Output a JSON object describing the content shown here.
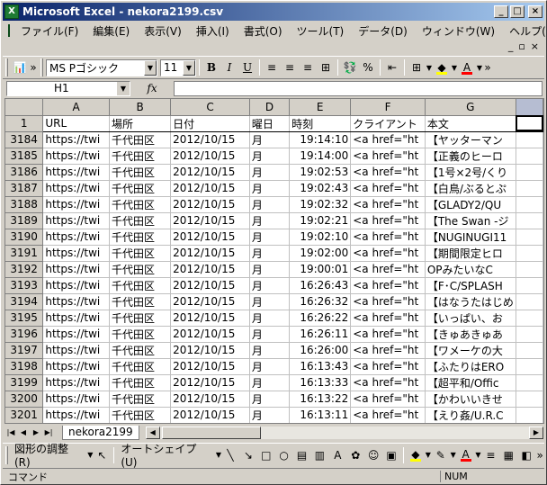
{
  "window": {
    "title": "Microsoft Excel - nekora2199.csv",
    "icon_label": "X"
  },
  "menu": [
    "ファイル(F)",
    "編集(E)",
    "表示(V)",
    "挿入(I)",
    "書式(O)",
    "ツール(T)",
    "データ(D)",
    "ウィンドウ(W)",
    "ヘルプ(H)"
  ],
  "toolbar": {
    "font": "MS Pゴシック",
    "size": "11",
    "bold": "B",
    "italic": "I",
    "underline": "U"
  },
  "formula": {
    "namebox": "H1",
    "fx": "fx",
    "value": ""
  },
  "columns": [
    "A",
    "B",
    "C",
    "D",
    "E",
    "F",
    "G"
  ],
  "selected_column": "H",
  "header_row": {
    "num": "1",
    "cells": [
      "URL",
      "場所",
      "日付",
      "曜日",
      "時刻",
      "クライアント",
      "本文"
    ]
  },
  "rows": [
    {
      "num": "3184",
      "cells": [
        "https://twi",
        "千代田区",
        "2012/10/15",
        "月",
        "19:14:10",
        "<a href=\"ht",
        "【ヤッターマン"
      ]
    },
    {
      "num": "3185",
      "cells": [
        "https://twi",
        "千代田区",
        "2012/10/15",
        "月",
        "19:14:00",
        "<a href=\"ht",
        "【正義のヒーロ"
      ]
    },
    {
      "num": "3186",
      "cells": [
        "https://twi",
        "千代田区",
        "2012/10/15",
        "月",
        "19:02:53",
        "<a href=\"ht",
        "【1号×2号/くり"
      ]
    },
    {
      "num": "3187",
      "cells": [
        "https://twi",
        "千代田区",
        "2012/10/15",
        "月",
        "19:02:43",
        "<a href=\"ht",
        "【白鳥/ぶるとぷ"
      ]
    },
    {
      "num": "3188",
      "cells": [
        "https://twi",
        "千代田区",
        "2012/10/15",
        "月",
        "19:02:32",
        "<a href=\"ht",
        "【GLADY2/QU"
      ]
    },
    {
      "num": "3189",
      "cells": [
        "https://twi",
        "千代田区",
        "2012/10/15",
        "月",
        "19:02:21",
        "<a href=\"ht",
        "【The Swan -ジ"
      ]
    },
    {
      "num": "3190",
      "cells": [
        "https://twi",
        "千代田区",
        "2012/10/15",
        "月",
        "19:02:10",
        "<a href=\"ht",
        "【NUGINUGI11"
      ]
    },
    {
      "num": "3191",
      "cells": [
        "https://twi",
        "千代田区",
        "2012/10/15",
        "月",
        "19:02:00",
        "<a href=\"ht",
        "【期間限定ヒロ"
      ]
    },
    {
      "num": "3192",
      "cells": [
        "https://twi",
        "千代田区",
        "2012/10/15",
        "月",
        "19:00:01",
        "<a href=\"ht",
        "OPみたいなC"
      ]
    },
    {
      "num": "3193",
      "cells": [
        "https://twi",
        "千代田区",
        "2012/10/15",
        "月",
        "16:26:43",
        "<a href=\"ht",
        "【F･C/SPLASH"
      ]
    },
    {
      "num": "3194",
      "cells": [
        "https://twi",
        "千代田区",
        "2012/10/15",
        "月",
        "16:26:32",
        "<a href=\"ht",
        "【はなうたはじめ"
      ]
    },
    {
      "num": "3195",
      "cells": [
        "https://twi",
        "千代田区",
        "2012/10/15",
        "月",
        "16:26:22",
        "<a href=\"ht",
        "【いっぱい、お"
      ]
    },
    {
      "num": "3196",
      "cells": [
        "https://twi",
        "千代田区",
        "2012/10/15",
        "月",
        "16:26:11",
        "<a href=\"ht",
        "【きゅあきゅあ"
      ]
    },
    {
      "num": "3197",
      "cells": [
        "https://twi",
        "千代田区",
        "2012/10/15",
        "月",
        "16:26:00",
        "<a href=\"ht",
        "【ワメーケの大"
      ]
    },
    {
      "num": "3198",
      "cells": [
        "https://twi",
        "千代田区",
        "2012/10/15",
        "月",
        "16:13:43",
        "<a href=\"ht",
        "【ふたりはERO"
      ]
    },
    {
      "num": "3199",
      "cells": [
        "https://twi",
        "千代田区",
        "2012/10/15",
        "月",
        "16:13:33",
        "<a href=\"ht",
        "【超平和/Offic"
      ]
    },
    {
      "num": "3200",
      "cells": [
        "https://twi",
        "千代田区",
        "2012/10/15",
        "月",
        "16:13:22",
        "<a href=\"ht",
        "【かわいいきせ"
      ]
    },
    {
      "num": "3201",
      "cells": [
        "https://twi",
        "千代田区",
        "2012/10/15",
        "月",
        "16:13:11",
        "<a href=\"ht",
        "【えり姦/U.R.C"
      ]
    }
  ],
  "sheet_tab": "nekora2199",
  "drawing": {
    "adjust": "図形の調整(R)",
    "autoshape": "オートシェイプ(U)"
  },
  "status": {
    "mode": "コマンド",
    "num": "NUM"
  },
  "colors": {
    "title_start": "#0a246a",
    "title_end": "#a6caf0",
    "chrome": "#d4d0c8",
    "fill_yellow": "#ffff00",
    "font_red": "#ff0000"
  }
}
